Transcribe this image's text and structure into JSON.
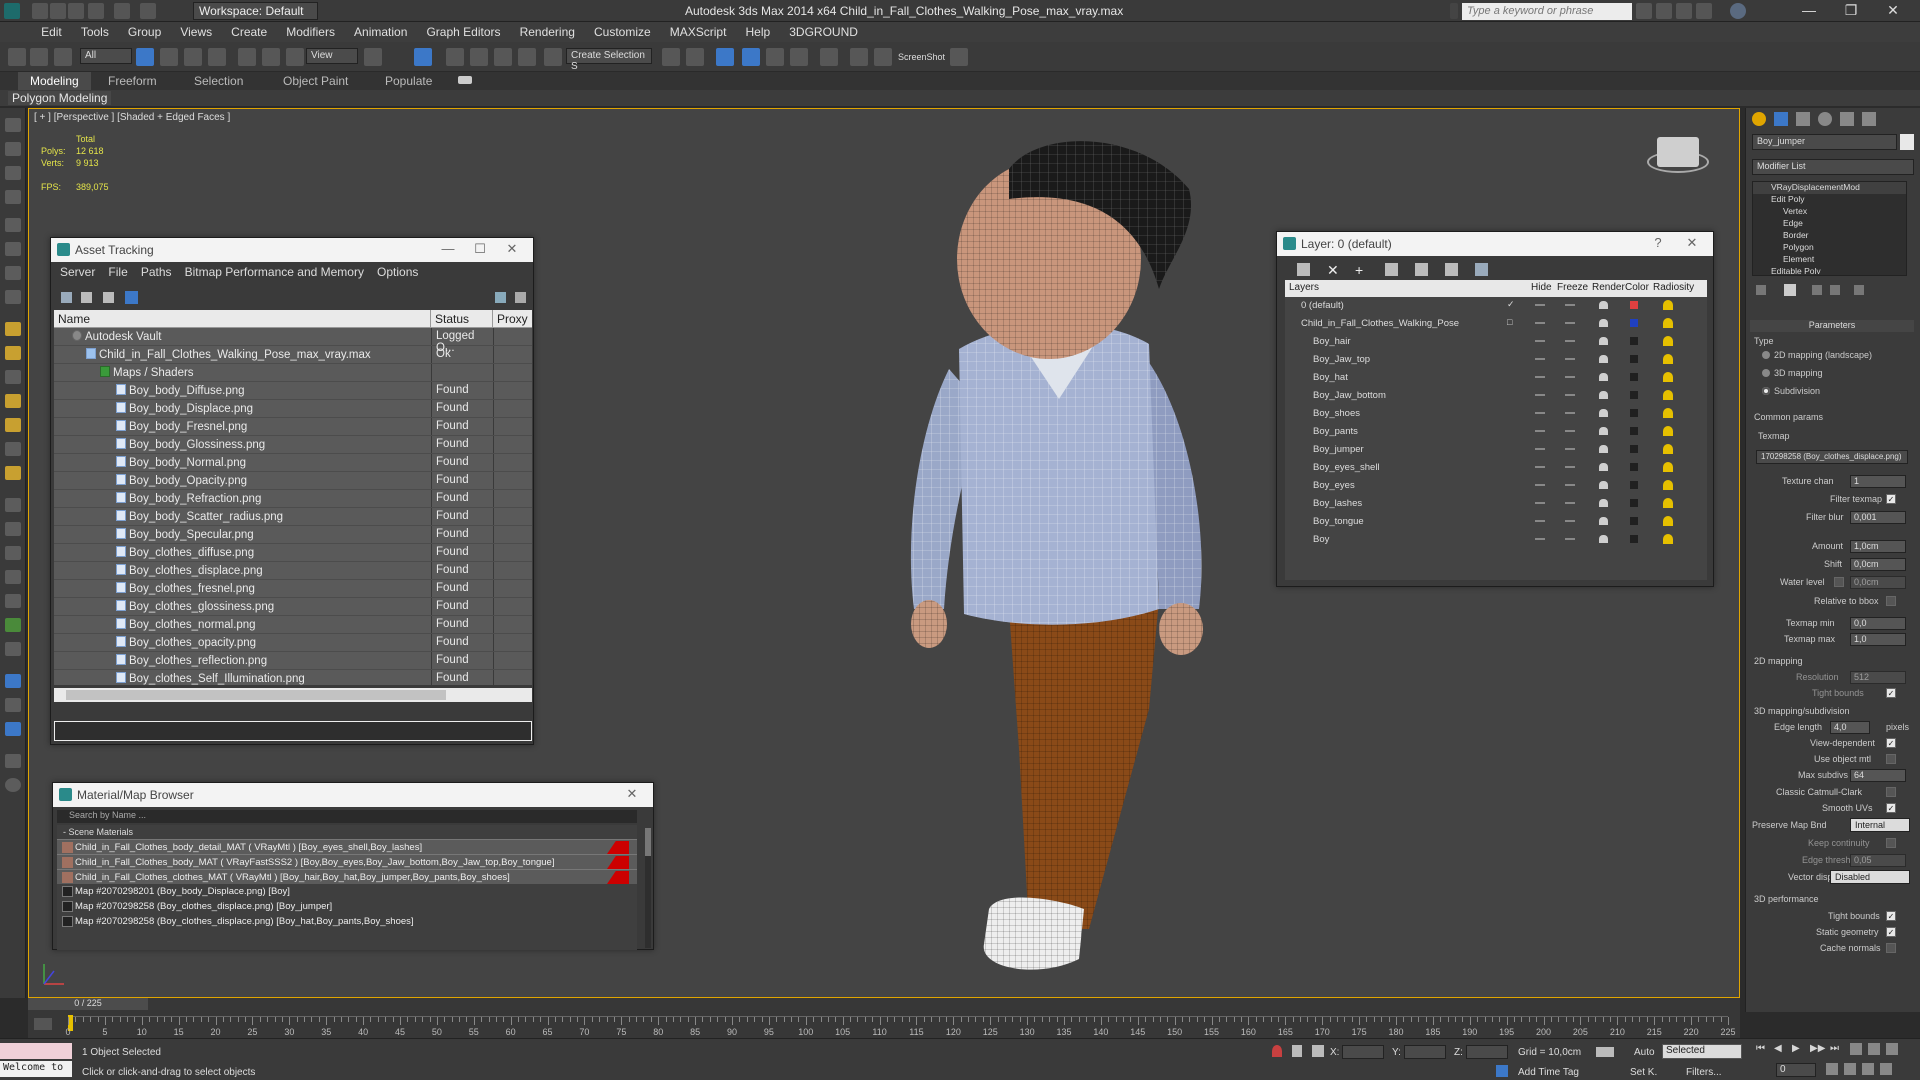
{
  "app": {
    "title": "Autodesk 3ds Max  2014 x64    Child_in_Fall_Clothes_Walking_Pose_max_vray.max",
    "workspace": "Workspace: Default",
    "search_placeholder": "Type a keyword or phrase"
  },
  "menu": [
    "Edit",
    "Tools",
    "Group",
    "Views",
    "Create",
    "Modifiers",
    "Animation",
    "Graph Editors",
    "Rendering",
    "Customize",
    "MAXScript",
    "Help",
    "3DGROUND"
  ],
  "toolbar": {
    "selection_filter": "All",
    "ref_coord": "View",
    "named_selection": "Create Selection S",
    "screenshot_label": "ScreenShot"
  },
  "ribbon": {
    "tabs": [
      "Modeling",
      "Freeform",
      "Selection",
      "Object Paint",
      "Populate"
    ],
    "sub_label": "Polygon Modeling"
  },
  "viewport": {
    "label": "[ + ] [Perspective ] [Shaded + Edged Faces ]",
    "stats": {
      "total_label": "Total",
      "polys_label": "Polys:",
      "polys": "12 618",
      "verts_label": "Verts:",
      "verts": "9 913",
      "fps_label": "FPS:",
      "fps": "389,075"
    }
  },
  "asset_tracking": {
    "title": "Asset Tracking",
    "menu": [
      "Server",
      "File",
      "Paths",
      "Bitmap Performance and Memory",
      "Options"
    ],
    "columns": [
      "Name",
      "Status",
      "Proxy R"
    ],
    "rows": [
      {
        "name": "Autodesk Vault",
        "status": "Logged O...",
        "indent": 0,
        "icon": "vault"
      },
      {
        "name": "Child_in_Fall_Clothes_Walking_Pose_max_vray.max",
        "status": "Ok",
        "indent": 1,
        "icon": "max"
      },
      {
        "name": "Maps / Shaders",
        "status": "",
        "indent": 2,
        "icon": "folder"
      },
      {
        "name": "Boy_body_Diffuse.png",
        "status": "Found",
        "indent": 3,
        "icon": "file"
      },
      {
        "name": "Boy_body_Displace.png",
        "status": "Found",
        "indent": 3,
        "icon": "file"
      },
      {
        "name": "Boy_body_Fresnel.png",
        "status": "Found",
        "indent": 3,
        "icon": "file"
      },
      {
        "name": "Boy_body_Glossiness.png",
        "status": "Found",
        "indent": 3,
        "icon": "file"
      },
      {
        "name": "Boy_body_Normal.png",
        "status": "Found",
        "indent": 3,
        "icon": "file"
      },
      {
        "name": "Boy_body_Opacity.png",
        "status": "Found",
        "indent": 3,
        "icon": "file"
      },
      {
        "name": "Boy_body_Refraction.png",
        "status": "Found",
        "indent": 3,
        "icon": "file"
      },
      {
        "name": "Boy_body_Scatter_radius.png",
        "status": "Found",
        "indent": 3,
        "icon": "file"
      },
      {
        "name": "Boy_body_Specular.png",
        "status": "Found",
        "indent": 3,
        "icon": "file"
      },
      {
        "name": "Boy_clothes_diffuse.png",
        "status": "Found",
        "indent": 3,
        "icon": "file"
      },
      {
        "name": "Boy_clothes_displace.png",
        "status": "Found",
        "indent": 3,
        "icon": "file"
      },
      {
        "name": "Boy_clothes_fresnel.png",
        "status": "Found",
        "indent": 3,
        "icon": "file"
      },
      {
        "name": "Boy_clothes_glossiness.png",
        "status": "Found",
        "indent": 3,
        "icon": "file"
      },
      {
        "name": "Boy_clothes_normal.png",
        "status": "Found",
        "indent": 3,
        "icon": "file"
      },
      {
        "name": "Boy_clothes_opacity.png",
        "status": "Found",
        "indent": 3,
        "icon": "file"
      },
      {
        "name": "Boy_clothes_reflection.png",
        "status": "Found",
        "indent": 3,
        "icon": "file"
      },
      {
        "name": "Boy_clothes_Self_Illumination.png",
        "status": "Found",
        "indent": 3,
        "icon": "file"
      }
    ]
  },
  "layer_manager": {
    "title": "Layer: 0 (default)",
    "columns": [
      "Layers",
      "Hide",
      "Freeze",
      "Render",
      "Color",
      "Radiosity"
    ],
    "rows": [
      {
        "name": "0 (default)",
        "indent": 0,
        "color": "#e04040",
        "active": true
      },
      {
        "name": "Child_in_Fall_Clothes_Walking_Pose",
        "indent": 0,
        "color": "#2040c0",
        "active": false
      },
      {
        "name": "Boy_hair",
        "indent": 1,
        "color": "#202020"
      },
      {
        "name": "Boy_Jaw_top",
        "indent": 1,
        "color": "#202020"
      },
      {
        "name": "Boy_hat",
        "indent": 1,
        "color": "#202020"
      },
      {
        "name": "Boy_Jaw_bottom",
        "indent": 1,
        "color": "#202020"
      },
      {
        "name": "Boy_shoes",
        "indent": 1,
        "color": "#202020"
      },
      {
        "name": "Boy_pants",
        "indent": 1,
        "color": "#202020"
      },
      {
        "name": "Boy_jumper",
        "indent": 1,
        "color": "#202020"
      },
      {
        "name": "Boy_eyes_shell",
        "indent": 1,
        "color": "#202020"
      },
      {
        "name": "Boy_eyes",
        "indent": 1,
        "color": "#202020"
      },
      {
        "name": "Boy_lashes",
        "indent": 1,
        "color": "#202020"
      },
      {
        "name": "Boy_tongue",
        "indent": 1,
        "color": "#202020"
      },
      {
        "name": "Boy",
        "indent": 1,
        "color": "#202020"
      }
    ]
  },
  "material_browser": {
    "title": "Material/Map Browser",
    "search_placeholder": "Search by Name ...",
    "group_label": "- Scene Materials",
    "rows": [
      {
        "text": "Child_in_Fall_Clothes_body_detail_MAT ( VRayMtl ) [Boy_eyes_shell,Boy_lashes]",
        "kind": "mat"
      },
      {
        "text": "Child_in_Fall_Clothes_body_MAT ( VRayFastSSS2 ) [Boy,Boy_eyes,Boy_Jaw_bottom,Boy_Jaw_top,Boy_tongue]",
        "kind": "mat"
      },
      {
        "text": "Child_in_Fall_Clothes_clothes_MAT ( VRayMtl ) [Boy_hair,Boy_hat,Boy_jumper,Boy_pants,Boy_shoes]",
        "kind": "mat"
      },
      {
        "text": "Map #2070298201 (Boy_body_Displace.png) [Boy]",
        "kind": "map"
      },
      {
        "text": "Map #2070298258 (Boy_clothes_displace.png) [Boy_jumper]",
        "kind": "map"
      },
      {
        "text": "Map #2070298258 (Boy_clothes_displace.png) [Boy_hat,Boy_pants,Boy_shoes]",
        "kind": "map"
      }
    ]
  },
  "command_panel": {
    "object_name": "Boy_jumper",
    "modifier_list": "Modifier List",
    "stack": [
      "VRayDisplacementMod",
      "Edit Poly",
      "Vertex",
      "Edge",
      "Border",
      "Polygon",
      "Element",
      "Editable Poly"
    ],
    "parameters_title": "Parameters",
    "type_label": "Type",
    "type_options": [
      "2D mapping (landscape)",
      "3D mapping",
      "Subdivision"
    ],
    "common_params": "Common params",
    "texmap_label": "Texmap",
    "texmap_value": "170298258 (Boy_clothes_displace.png)",
    "texture_chan_label": "Texture chan",
    "texture_chan": "1",
    "filter_texmap_label": "Filter texmap",
    "filter_blur_label": "Filter blur",
    "filter_blur": "0,001",
    "amount_label": "Amount",
    "amount": "1,0cm",
    "shift_label": "Shift",
    "shift": "0,0cm",
    "water_level_label": "Water level",
    "water_level": "0,0cm",
    "relative_bbox_label": "Relative to bbox",
    "texmap_min_label": "Texmap min",
    "texmap_min": "0,0",
    "texmap_max_label": "Texmap max",
    "texmap_max": "1,0",
    "mapping2d_label": "2D mapping",
    "resolution_label": "Resolution",
    "resolution": "512",
    "tight_bounds_label": "Tight bounds",
    "mapping3d_label": "3D mapping/subdivision",
    "edge_length_label": "Edge length",
    "edge_length": "4,0",
    "pixels_label": "pixels",
    "view_dependent_label": "View-dependent",
    "use_object_mtl_label": "Use object mtl",
    "max_subdivs_label": "Max subdivs",
    "max_subdivs": "64",
    "catmull_label": "Classic Catmull-Clark",
    "smooth_uvs_label": "Smooth UVs",
    "preserve_map_label": "Preserve Map Bnd",
    "preserve_map": "Internal",
    "keep_continuity_label": "Keep continuity",
    "edge_thresh_label": "Edge thresh",
    "edge_thresh": "0,05",
    "vector_displ_label": "Vector displ",
    "vector_displ": "Disabled",
    "perf_label": "3D performance",
    "perf_tight_label": "Tight bounds",
    "static_geom_label": "Static geometry",
    "cache_normals_label": "Cache normals"
  },
  "timeline": {
    "current": "0 / 225",
    "ticks": [
      0,
      5,
      10,
      15,
      20,
      25,
      30,
      35,
      40,
      45,
      50,
      55,
      60,
      65,
      70,
      75,
      80,
      85,
      90,
      95,
      100,
      105,
      110,
      115,
      120,
      125,
      130,
      135,
      140,
      145,
      150,
      155,
      160,
      165,
      170,
      175,
      180,
      185,
      190,
      195,
      200,
      205,
      210,
      215,
      220,
      225
    ],
    "range": [
      0,
      225
    ]
  },
  "status": {
    "welcome": "Welcome to",
    "selected": "1 Object Selected",
    "prompt": "Click or click-and-drag to select objects",
    "x_label": "X:",
    "y_label": "Y:",
    "z_label": "Z:",
    "grid": "Grid = 10,0cm",
    "add_time_tag": "Add Time Tag",
    "auto": "Auto",
    "set_k": "Set K.",
    "selected_drop": "Selected",
    "filters": "Filters...",
    "frame": "0"
  }
}
